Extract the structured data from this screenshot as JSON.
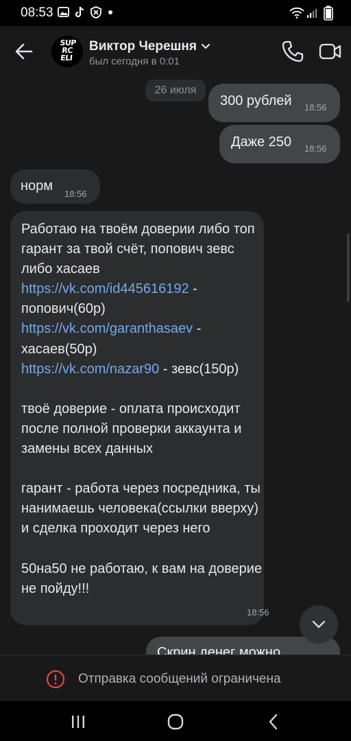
{
  "status_bar": {
    "time": "08:53",
    "icons": [
      "gallery-icon",
      "tiktok-icon",
      "shield-icon",
      "dot-icon",
      "wifi-icon",
      "signal-icon",
      "battery-icon"
    ]
  },
  "header": {
    "contact_name": "Виктор Черешня",
    "last_seen": "был сегодня в 0:01",
    "avatar_text": [
      "SUP",
      "RC",
      "ELI"
    ]
  },
  "chat": {
    "date_separator": "26 июля",
    "messages": [
      {
        "direction": "out",
        "text": "300 рублей",
        "time": "18:56"
      },
      {
        "direction": "out",
        "text": "Даже 250",
        "time": "18:56"
      },
      {
        "direction": "in",
        "text": "норм",
        "time": "18:56"
      },
      {
        "direction": "in",
        "time": "18:56",
        "parts": {
          "p1": "Работаю на твоём доверии либо топ гарант за твой счёт, попович зевс либо хасаев\n",
          "link1": "https://vk.com/id445616192",
          "p2": " - попович(60р)\n",
          "link2": "https://vk.com/garanthasaev",
          "p3": " - хасаев(50р)\n",
          "link3": "https://vk.com/nazar90",
          "p4": " - зевс(150р)\n\nтвоё доверие - оплата происходит после полной проверки аккаунта и замены всех данных\n\nгарант - работа через посредника, ты нанимаешь человека(ссылки вверху) и сделка проходит через него\n\n50на50 не работаю, к вам на доверие не пойду!!!"
        }
      },
      {
        "direction": "out",
        "text": "Скрин денег можно",
        "time": ""
      }
    ]
  },
  "restriction": {
    "text": "Отправка сообщений ограничена"
  },
  "colors": {
    "background": "#19191a",
    "outgoing_bubble": "#444548",
    "incoming_bubble": "#2c2d2f",
    "link": "#71aaeb",
    "warning": "#e64646"
  }
}
